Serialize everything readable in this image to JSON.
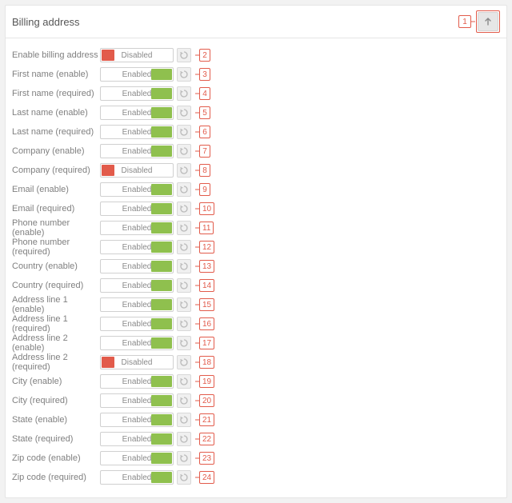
{
  "panel": {
    "title": "Billing address",
    "collapse_callout": "1"
  },
  "text": {
    "enabled": "Enabled",
    "disabled": "Disabled"
  },
  "rows": [
    {
      "label": "Enable billing address",
      "enabled": false,
      "callout": "2"
    },
    {
      "label": "First name (enable)",
      "enabled": true,
      "callout": "3"
    },
    {
      "label": "First name (required)",
      "enabled": true,
      "callout": "4"
    },
    {
      "label": "Last name (enable)",
      "enabled": true,
      "callout": "5"
    },
    {
      "label": "Last name (required)",
      "enabled": true,
      "callout": "6"
    },
    {
      "label": "Company (enable)",
      "enabled": true,
      "callout": "7"
    },
    {
      "label": "Company (required)",
      "enabled": false,
      "callout": "8"
    },
    {
      "label": "Email (enable)",
      "enabled": true,
      "callout": "9"
    },
    {
      "label": "Email (required)",
      "enabled": true,
      "callout": "10"
    },
    {
      "label": "Phone number (enable)",
      "enabled": true,
      "callout": "11"
    },
    {
      "label": "Phone number (required)",
      "enabled": true,
      "callout": "12"
    },
    {
      "label": "Country (enable)",
      "enabled": true,
      "callout": "13"
    },
    {
      "label": "Country (required)",
      "enabled": true,
      "callout": "14"
    },
    {
      "label": "Address line 1 (enable)",
      "enabled": true,
      "callout": "15"
    },
    {
      "label": "Address line 1 (required)",
      "enabled": true,
      "callout": "16"
    },
    {
      "label": "Address line 2 (enable)",
      "enabled": true,
      "callout": "17"
    },
    {
      "label": "Address line 2 (required)",
      "enabled": false,
      "callout": "18"
    },
    {
      "label": "City (enable)",
      "enabled": true,
      "callout": "19"
    },
    {
      "label": "City (required)",
      "enabled": true,
      "callout": "20"
    },
    {
      "label": "State (enable)",
      "enabled": true,
      "callout": "21"
    },
    {
      "label": "State (required)",
      "enabled": true,
      "callout": "22"
    },
    {
      "label": "Zip code (enable)",
      "enabled": true,
      "callout": "23"
    },
    {
      "label": "Zip code (required)",
      "enabled": true,
      "callout": "24"
    }
  ]
}
